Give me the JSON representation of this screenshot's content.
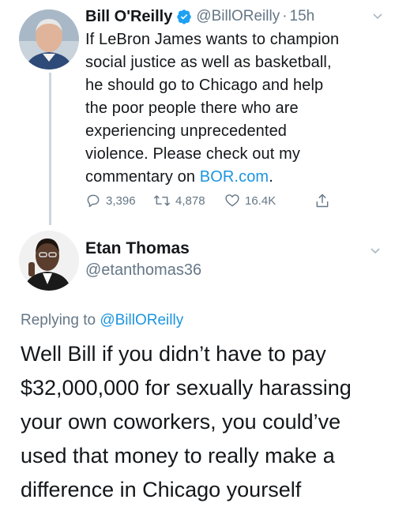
{
  "tweet": {
    "author_name": "Bill O'Reilly",
    "author_handle": "@BillOReilly",
    "time": "15h",
    "text_lines": [
      "If LeBron James wants to champion",
      "social justice as well as basketball,",
      "he should go to Chicago and help",
      "the poor people there who are",
      "experiencing unprecedented",
      "violence. Please check out my"
    ],
    "text_last_prefix": "commentary on ",
    "text_link": "BOR.com",
    "text_last_suffix": ".",
    "replies": "3,396",
    "retweets": "4,878",
    "likes": "16.4K"
  },
  "reply": {
    "author_name": "Etan Thomas",
    "author_handle": "@etanthomas36",
    "replying_to_prefix": "Replying to ",
    "replying_to_handle": "@BillOReilly",
    "text_lines": [
      "Well Bill if you didn’t have to pay",
      "$32,000,000 for sexually harassing",
      "your own coworkers, you could’ve",
      "used that money to really make a",
      "difference in Chicago yourself"
    ]
  },
  "colors": {
    "link": "#1b95e0",
    "secondary_text": "#657786",
    "verified": "#1da1f2",
    "thread_line": "#ccd6dd"
  }
}
